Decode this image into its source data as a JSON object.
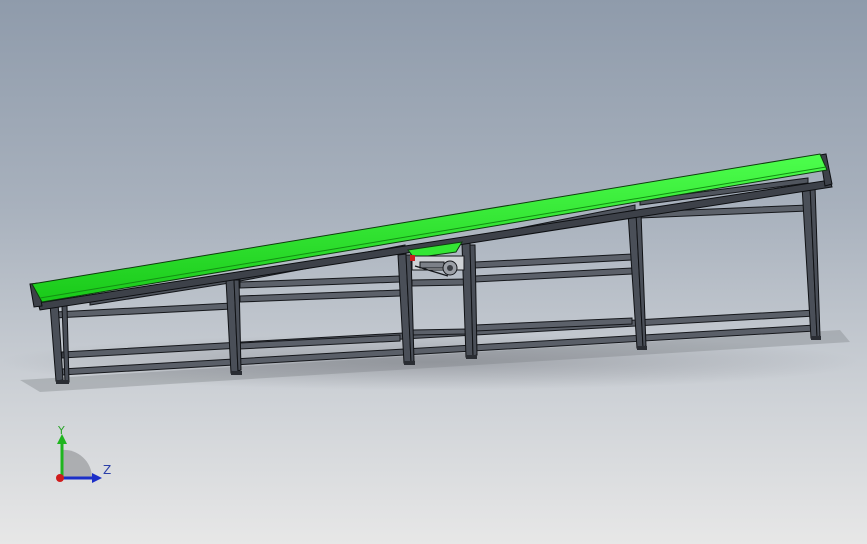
{
  "viewport": {
    "background_top": "#8f9bab",
    "background_bottom": "#e7e7e7"
  },
  "model": {
    "belt_color": "#22e822",
    "frame_color": "#4a4f58",
    "frame_edge_color": "#101215"
  },
  "triad": {
    "y_label": "Y",
    "z_label": "Z",
    "y_color": "#1fb51f",
    "z_color": "#1c2fc8",
    "x_color": "#d01c1c"
  }
}
